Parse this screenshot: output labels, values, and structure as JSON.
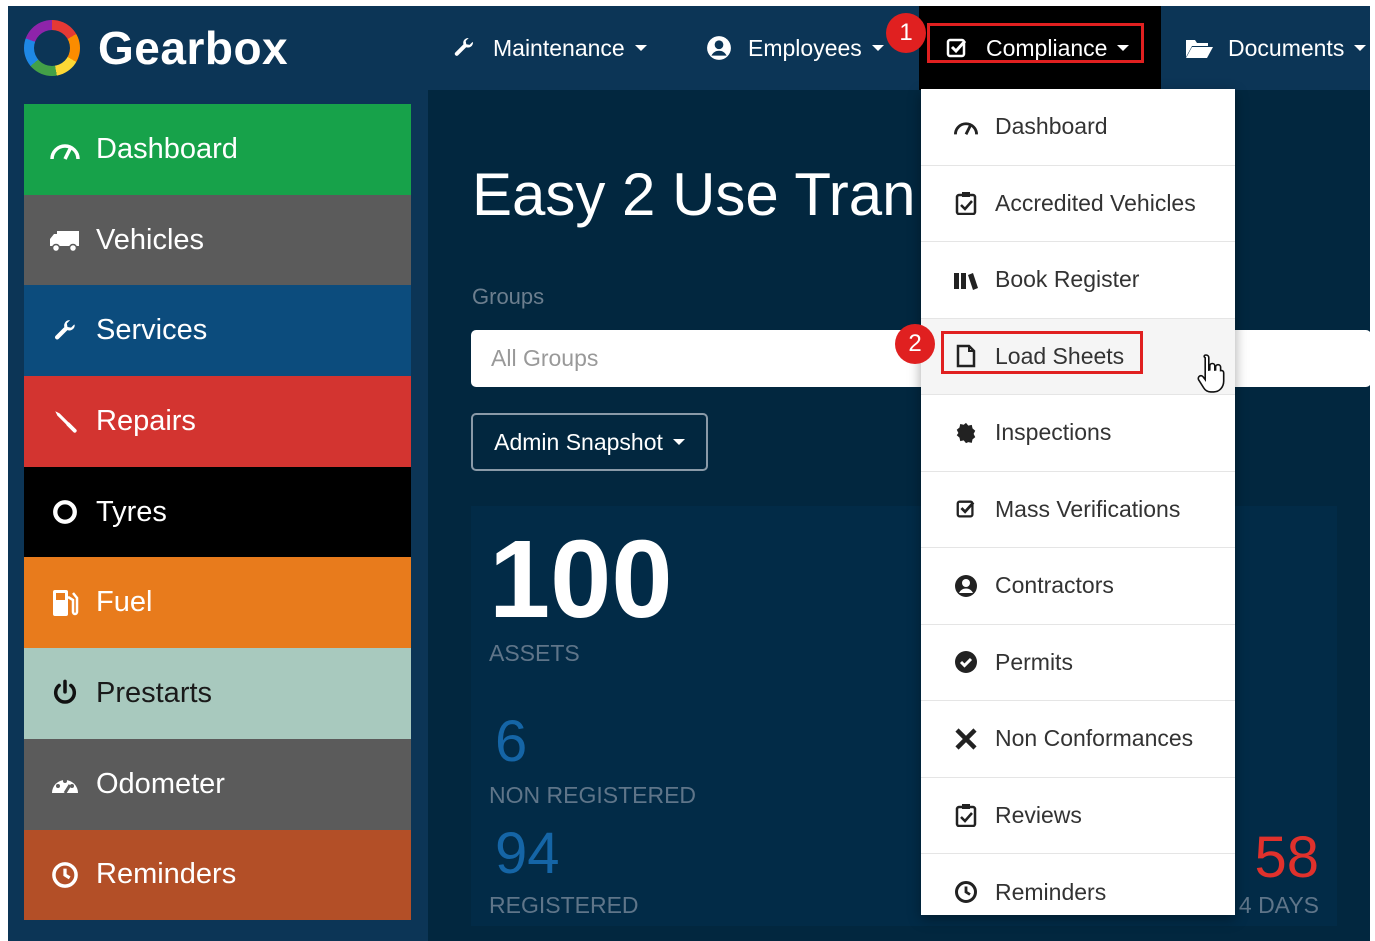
{
  "app": {
    "name": "Gearbox"
  },
  "topnav": [
    {
      "label": "Maintenance",
      "icon": "wrench-icon"
    },
    {
      "label": "Employees",
      "icon": "user-circle-icon"
    },
    {
      "label": "Compliance",
      "icon": "check-square-icon"
    },
    {
      "label": "Documents",
      "icon": "folder-open-icon"
    }
  ],
  "sidebar": {
    "items": [
      {
        "label": "Dashboard",
        "icon": "dashboard-gauge-icon",
        "color": "#17a24a"
      },
      {
        "label": "Vehicles",
        "icon": "truck-icon",
        "color": "#5b5b5b"
      },
      {
        "label": "Services",
        "icon": "wrench-icon",
        "color": "#0c4c7d"
      },
      {
        "label": "Repairs",
        "icon": "screwdriver-icon",
        "color": "#d33430"
      },
      {
        "label": "Tyres",
        "icon": "ring-icon",
        "color": "#000000"
      },
      {
        "label": "Fuel",
        "icon": "fuel-pump-icon",
        "color": "#e87b1c"
      },
      {
        "label": "Prestarts",
        "icon": "power-icon",
        "color": "#a8c9be"
      },
      {
        "label": "Odometer",
        "icon": "speedometer-icon",
        "color": "#5b5b5b"
      },
      {
        "label": "Reminders",
        "icon": "clock-icon",
        "color": "#b34f27"
      }
    ]
  },
  "main": {
    "title": "Easy 2 Use Tran",
    "groups_label": "Groups",
    "groups_placeholder": "All Groups",
    "snapshot_button": "Admin Snapshot",
    "stats": {
      "assets_value": "100",
      "assets_label": "ASSETS",
      "non_registered_value": "6",
      "non_registered_label": "NON REGISTERED",
      "registered_value": "94",
      "registered_label": "REGISTERED",
      "right_value": "58",
      "right_label": "4 DAYS"
    }
  },
  "dropdown": {
    "items": [
      {
        "label": "Dashboard",
        "icon": "dashboard-gauge-icon"
      },
      {
        "label": "Accredited Vehicles",
        "icon": "clipboard-check-icon"
      },
      {
        "label": "Book Register",
        "icon": "books-icon"
      },
      {
        "label": "Load Sheets",
        "icon": "file-icon"
      },
      {
        "label": "Inspections",
        "icon": "gear-badge-icon"
      },
      {
        "label": "Mass Verifications",
        "icon": "check-square-icon"
      },
      {
        "label": "Contractors",
        "icon": "user-circle-icon"
      },
      {
        "label": "Permits",
        "icon": "check-circle-icon"
      },
      {
        "label": "Non Conformances",
        "icon": "times-icon"
      },
      {
        "label": "Reviews",
        "icon": "clipboard-check-icon"
      },
      {
        "label": "Reminders",
        "icon": "clock-icon"
      }
    ]
  },
  "annotations": {
    "step1": "1",
    "step2": "2"
  },
  "colors": {
    "header_bg": "#0c3556",
    "main_bg": "#02273f",
    "highlight_red": "#e02020"
  }
}
